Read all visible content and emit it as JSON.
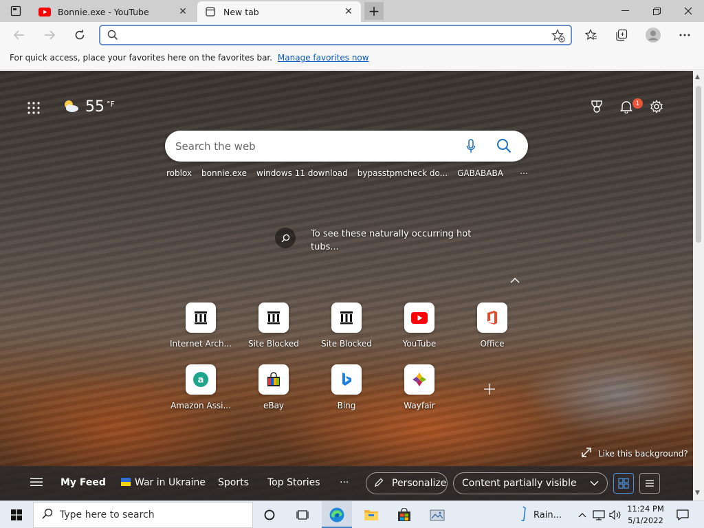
{
  "tabs": [
    {
      "label": "Bonnie.exe - YouTube",
      "icon": "youtube-icon"
    },
    {
      "label": "New tab",
      "icon": "newtab-icon"
    }
  ],
  "address_bar": {
    "value": "",
    "placeholder": ""
  },
  "favorites_bar": {
    "message": "For quick access, place your favorites here on the favorites bar.",
    "link": "Manage favorites now"
  },
  "weather": {
    "temperature": "55",
    "unit": "°F"
  },
  "notifications": {
    "count": "1"
  },
  "search": {
    "placeholder": "Search the web"
  },
  "trending": [
    "roblox",
    "bonnie.exe",
    "windows 11 download",
    "bypasstpmcheck do...",
    "GABABABA",
    "⋯"
  ],
  "background_caption": "To see these naturally occurring hot tubs...",
  "quick_links": [
    {
      "label": "Internet Arch...",
      "icon": "archive-icon"
    },
    {
      "label": "Site Blocked",
      "icon": "archive-icon"
    },
    {
      "label": "Site Blocked",
      "icon": "archive-icon"
    },
    {
      "label": "YouTube",
      "icon": "youtube-icon"
    },
    {
      "label": "Office",
      "icon": "office-icon"
    },
    {
      "label": "Amazon Assi...",
      "icon": "amazon-icon"
    },
    {
      "label": "eBay",
      "icon": "ebay-icon"
    },
    {
      "label": "Bing",
      "icon": "bing-icon"
    },
    {
      "label": "Wayfair",
      "icon": "wayfair-icon"
    }
  ],
  "like_background": "Like this background?",
  "feed": {
    "my_feed": "My Feed",
    "items": [
      "War in Ukraine",
      "Sports",
      "Top Stories"
    ],
    "more": "···",
    "personalize": "Personalize",
    "content_visibility": "Content partially visible"
  },
  "taskbar": {
    "search_placeholder": "Type here to search",
    "weather": "Rain...",
    "time": "11:24 PM",
    "date": "5/1/2022"
  },
  "colors": {
    "accent": "#6b8fc9",
    "badge": "#e7553b",
    "youtube": "#ff0000",
    "link": "#0a58c2"
  }
}
